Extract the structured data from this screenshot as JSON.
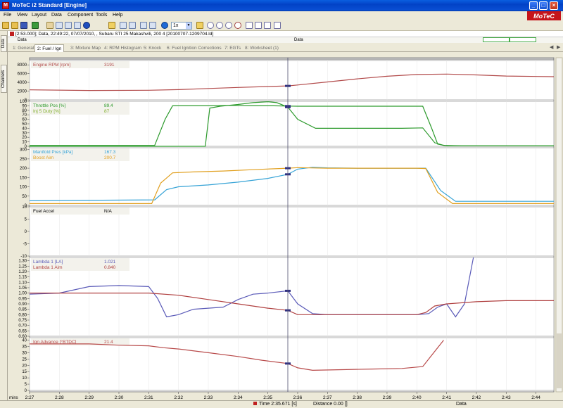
{
  "window": {
    "title": "MoTeC i2 Standard [Engine]",
    "logo": "MoTeC",
    "minimize": "_",
    "maximize": "□",
    "close": "×"
  },
  "menu": [
    "File",
    "View",
    "Layout",
    "Data",
    "Component",
    "Tools",
    "Help"
  ],
  "toolbar": {
    "zoom_value": "1x"
  },
  "side_tabs": [
    "Data",
    "Channels"
  ],
  "file_info": "[2:53.000]; Data, 22:49:22, 07/07/2010, , Subaru STI 25 Makashvili, 200 4 [20100707-1209704.ld]",
  "data_row": {
    "left": "Data",
    "middle": "Data"
  },
  "worksheet_tabs": [
    {
      "label": "1: General",
      "active": false
    },
    {
      "label": "2: Fuel / Ign",
      "active": true
    },
    {
      "label": "3: Mixture Map",
      "active": false
    },
    {
      "label": "4: RPM Histogram",
      "active": false
    },
    {
      "label": "5: Knock",
      "active": false
    },
    {
      "label": "6: Fuel Ignition Corrections",
      "active": false
    },
    {
      "label": "7: EGTs",
      "active": false
    },
    {
      "label": "8: Worksheet (1)",
      "active": false
    }
  ],
  "colors": {
    "rpm": "#b24a4a",
    "throttle": "#2c9a2c",
    "injduty": "#7fae2a",
    "manifold": "#36a3d6",
    "boost": "#e1a020",
    "lambda": "#5a5ab8",
    "lambda_aim": "#b04040",
    "ign": "#b84a4a",
    "cursor": "#303080"
  },
  "chart_data": {
    "type": "line",
    "x_unit": "mins",
    "x_ticks": [
      "2:27",
      "2:28",
      "2:29",
      "2:30",
      "2:31",
      "2:32",
      "2:33",
      "2:34",
      "2:35",
      "2:36",
      "2:37",
      "2:38",
      "2:39",
      "2:40",
      "2:41",
      "2:42",
      "2:43",
      "2:44"
    ],
    "xlim": [
      147,
      164.6
    ],
    "cursor_x": 155.67,
    "panels": [
      {
        "id": "rpm",
        "ylim": [
          0,
          9000
        ],
        "y_ticks": [
          "0",
          "2000",
          "4000",
          "6000",
          "8000"
        ],
        "y_tick_values": [
          0,
          2000,
          4000,
          6000,
          8000
        ],
        "legend": [
          {
            "name": "Engine RPM [rpm]",
            "value": "3191",
            "color": "#b24a4a"
          }
        ],
        "series": [
          {
            "name": "Engine RPM [rpm]",
            "color": "#b24a4a",
            "x": [
              147,
              149,
              151,
              152,
              153,
              154,
              155,
              155.67,
              156,
              157,
              158,
              159,
              160,
              161,
              162,
              163,
              164.6
            ],
            "y": [
              2300,
              2150,
              2200,
              2350,
              2600,
              2850,
              3050,
              3191,
              3400,
              4100,
              4800,
              5400,
              5800,
              5900,
              5700,
              5450,
              5300
            ]
          }
        ]
      },
      {
        "id": "throttle",
        "ylim": [
          0,
          100
        ],
        "y_ticks": [
          "0",
          "10",
          "20",
          "30",
          "40",
          "50",
          "60",
          "70",
          "80",
          "90",
          "100"
        ],
        "y_tick_values": [
          0,
          10,
          20,
          30,
          40,
          50,
          60,
          70,
          80,
          90,
          100
        ],
        "legend": [
          {
            "name": "Throttle Pos [%]",
            "value": "89.4",
            "color": "#2c9a2c"
          },
          {
            "name": "Inj 5 Duty [%]",
            "value": "87",
            "color": "#7fae2a"
          }
        ],
        "series": [
          {
            "name": "Throttle Pos [%]",
            "color": "#2c9a2c",
            "x": [
              147,
              151.2,
              151.55,
              151.8,
              152.2,
              153.0,
              153.8,
              154.5,
              155.2,
              155.67,
              156,
              157,
              158,
              159,
              160.2,
              160.5,
              160.7,
              161,
              164.6
            ],
            "y": [
              2,
              2,
              60,
              90,
              90,
              90,
              91,
              90,
              90,
              89.4,
              89,
              89,
              89,
              89,
              89,
              40,
              5,
              1,
              1
            ]
          },
          {
            "name": "Inj 5 Duty [%]",
            "color": "#2c9a2c",
            "x": [
              147,
              152.9,
              153.05,
              153.4,
              154,
              154.5,
              155,
              155.3,
              155.67,
              156,
              156.6,
              157.5,
              158.5,
              159.5,
              160.2,
              160.6,
              160.9,
              161.5,
              164.6
            ],
            "y": [
              0,
              0,
              85,
              89,
              93,
              97,
              99,
              97,
              87,
              60,
              40,
              40,
              40,
              40,
              41,
              8,
              2,
              1,
              1
            ]
          }
        ]
      },
      {
        "id": "map",
        "ylim": [
          0,
          310
        ],
        "y_ticks": [
          "0",
          "50",
          "100",
          "150",
          "200",
          "250",
          "300"
        ],
        "y_tick_values": [
          0,
          50,
          100,
          150,
          200,
          250,
          300
        ],
        "legend": [
          {
            "name": "Manifold Pres [kPa]",
            "value": "167.3",
            "color": "#36a3d6"
          },
          {
            "name": "Boost Aim",
            "value": "200.7",
            "color": "#e1a020"
          }
        ],
        "series": [
          {
            "name": "Manifold Pres [kPa]",
            "color": "#36a3d6",
            "x": [
              147,
              151.2,
              151.6,
              152,
              153,
              154,
              155,
              155.67,
              156,
              156.5,
              157,
              158,
              159,
              160,
              160.3,
              160.8,
              161.3,
              164.6
            ],
            "y": [
              25,
              30,
              85,
              100,
              110,
              125,
              145,
              167,
              195,
              205,
              202,
              200,
              200,
              200,
              200,
              80,
              22,
              22
            ]
          },
          {
            "name": "Boost Aim",
            "color": "#e1a020",
            "x": [
              147,
              151.1,
              151.4,
              151.8,
              152.5,
              153.5,
              154.5,
              155.67,
              156,
              157,
              158,
              159,
              160,
              160.3,
              160.7,
              161.2,
              164.6
            ],
            "y": [
              10,
              10,
              120,
              175,
              180,
              185,
              192,
              200,
              203,
              200,
              200,
              200,
              200,
              198,
              70,
              10,
              10
            ]
          }
        ]
      },
      {
        "id": "fuel_accel",
        "ylim": [
          -10,
          10
        ],
        "y_ticks": [
          "-10",
          "-5",
          "0",
          "5",
          "10"
        ],
        "y_tick_values": [
          -10,
          -5,
          0,
          5,
          10
        ],
        "legend": [
          {
            "name": "Fuel Accel",
            "value": "N/A",
            "color": "#000000"
          }
        ],
        "series": []
      },
      {
        "id": "lambda",
        "ylim": [
          0.6,
          1.33
        ],
        "y_ticks": [
          "0.60",
          "0.65",
          "0.70",
          "0.75",
          "0.80",
          "0.85",
          "0.90",
          "0.95",
          "1.00",
          "1.05",
          "1.10",
          "1.15",
          "1.20",
          "1.25",
          "1.30"
        ],
        "y_tick_values": [
          0.6,
          0.65,
          0.7,
          0.75,
          0.8,
          0.85,
          0.9,
          0.95,
          1.0,
          1.05,
          1.1,
          1.15,
          1.2,
          1.25,
          1.3
        ],
        "legend": [
          {
            "name": "Lambda 1 [LA]",
            "value": "1.021",
            "color": "#5a5ab8"
          },
          {
            "name": "Lambda 1 Aim",
            "value": "0.840",
            "color": "#b04040"
          }
        ],
        "series": [
          {
            "name": "Lambda 1 [LA]",
            "color": "#5a5ab8",
            "x": [
              147,
              148,
              149,
              150,
              151,
              151.3,
              151.6,
              152,
              152.5,
              153,
              153.5,
              154,
              154.5,
              155,
              155.67,
              156,
              156.5,
              157,
              158,
              159,
              160,
              160.4,
              160.7,
              161,
              161.3,
              161.6,
              161.9
            ],
            "y": [
              0.99,
              1.0,
              1.06,
              1.07,
              1.06,
              0.95,
              0.78,
              0.8,
              0.85,
              0.86,
              0.87,
              0.94,
              0.99,
              1.0,
              1.021,
              0.9,
              0.81,
              0.8,
              0.8,
              0.8,
              0.8,
              0.81,
              0.87,
              0.9,
              0.78,
              0.9,
              1.33
            ]
          },
          {
            "name": "Lambda 1 Aim",
            "color": "#b04040",
            "x": [
              147,
              148,
              149,
              150,
              151,
              152,
              153,
              154,
              155,
              155.67,
              156,
              157,
              158,
              159,
              160,
              160.3,
              160.6,
              161,
              162,
              163,
              164.6
            ],
            "y": [
              1.0,
              1.0,
              1.0,
              1.0,
              1.0,
              0.98,
              0.94,
              0.9,
              0.86,
              0.84,
              0.8,
              0.8,
              0.8,
              0.8,
              0.8,
              0.82,
              0.88,
              0.9,
              0.92,
              0.93,
              0.93
            ]
          }
        ]
      },
      {
        "id": "ign",
        "ylim": [
          0,
          42
        ],
        "y_ticks": [
          "0",
          "5",
          "10",
          "15",
          "20",
          "25",
          "30",
          "35",
          "40"
        ],
        "y_tick_values": [
          0,
          5,
          10,
          15,
          20,
          25,
          30,
          35,
          40
        ],
        "legend": [
          {
            "name": "Ign Advance [°BTDC]",
            "value": "21.4",
            "color": "#b84a4a"
          }
        ],
        "series": [
          {
            "name": "Ign Advance [°BTDC]",
            "color": "#b84a4a",
            "x": [
              147,
              149,
              150,
              151,
              151.5,
              152,
              153,
              154,
              154.8,
              155.67,
              156,
              156.5,
              157.5,
              158.5,
              159.5,
              160.2,
              160.5,
              160.9
            ],
            "y": [
              37,
              37,
              36,
              35.5,
              34,
              33,
              30,
              27,
              24,
              21.4,
              18,
              16,
              16.5,
              17,
              17.5,
              19,
              28,
              40
            ]
          }
        ]
      }
    ]
  },
  "status": {
    "time": "Time  2:35.671 [s]",
    "distance": "Distance  0.00 []",
    "right": "Data"
  }
}
